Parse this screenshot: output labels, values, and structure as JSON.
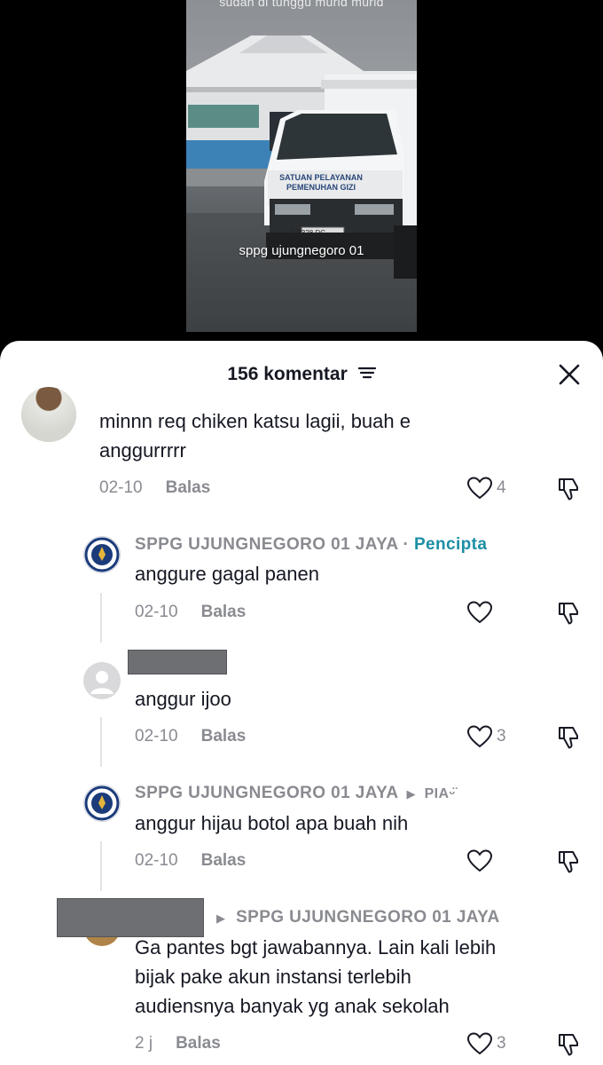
{
  "video": {
    "caption_top": "sudah di tunggu murid murid",
    "caption_mid": "sppg ujungnegoro 01",
    "van_text_line1": "SATUAN PELAYANAN",
    "van_text_line2": "PEMENUHAN GIZI",
    "plate": "G 8328 DC"
  },
  "sheet": {
    "comment_count": "156 komentar",
    "sort_icon": "sort-lines-icon",
    "close_icon": "close-icon"
  },
  "comments": [
    {
      "author": "",
      "text_line1": "minnn req chiken katsu lagii, buah e",
      "text_line2": "anggurrrrr",
      "date": "02-10",
      "reply_label": "Balas",
      "likes": "4"
    },
    {
      "author": "SPPG UJUNGNEGORO 01 JAYA",
      "separator": "·",
      "badge": "Pencipta",
      "text": "anggure gagal panen",
      "date": "02-10",
      "reply_label": "Balas",
      "likes": ""
    },
    {
      "author": "",
      "text": "anggur ijoo",
      "date": "02-10",
      "reply_label": "Balas",
      "likes": "3"
    },
    {
      "author": "SPPG UJUNGNEGORO 01 JAYA",
      "reply_to": "PIAᵕ̈",
      "text": "anggur hijau botol apa buah nih",
      "date": "02-10",
      "reply_label": "Balas",
      "likes": ""
    },
    {
      "author": "",
      "reply_to": "SPPG UJUNGNEGORO 01 JAYA",
      "text_line1": "Ga pantes bgt jawabannya. Lain kali lebih",
      "text_line2": "bijak pake akun instansi terlebih",
      "text_line3": "audiensnya banyak yg anak sekolah",
      "date": "2 j",
      "reply_label": "Balas",
      "likes": "3"
    }
  ],
  "colors": {
    "text_primary": "#161823",
    "text_secondary": "#8a8b91",
    "creator_badge": "#1c8ea5",
    "thread_line": "#e3e3e6"
  }
}
